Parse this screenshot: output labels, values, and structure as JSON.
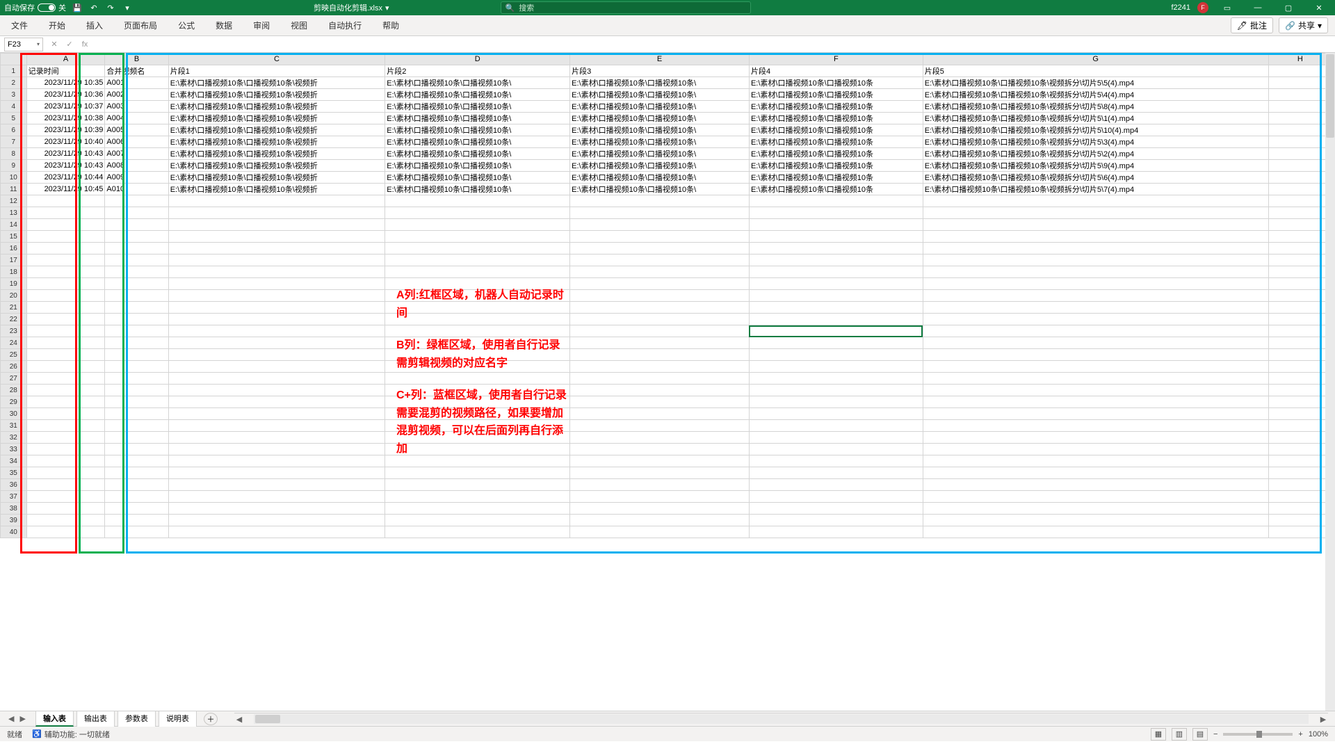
{
  "titlebar": {
    "autosave_label": "自动保存",
    "autosave_state": "关",
    "filename": "剪映自动化剪辑.xlsx",
    "search_placeholder": "搜索",
    "user_label": "f2241",
    "user_initial": "F"
  },
  "ribbon": {
    "tabs": [
      "文件",
      "开始",
      "插入",
      "页面布局",
      "公式",
      "数据",
      "审阅",
      "视图",
      "自动执行",
      "帮助"
    ],
    "comments": "批注",
    "share": "共享"
  },
  "fxbar": {
    "namebox": "F23",
    "fx_symbol": "fx"
  },
  "columns": [
    "A",
    "B",
    "C",
    "D",
    "E",
    "F",
    "G",
    "H"
  ],
  "headers": {
    "A": "记录时间",
    "B": "合并视频名",
    "C": "片段1",
    "D": "片段2",
    "E": "片段3",
    "F": "片段4",
    "G": "片段5"
  },
  "rows": [
    {
      "A": "2023/11/29 10:35",
      "B": "A001",
      "C": "E:\\素材\\口播视频10条\\口播视频10条\\视频折",
      "D": "E:\\素材\\口播视频10条\\口播视频10条\\",
      "E": "E:\\素材\\口播视频10条\\口播视频10条\\",
      "F": "E:\\素材\\口播视频10条\\口播视频10条",
      "G": "E:\\素材\\口播视频10条\\口播视频10条\\视频拆分\\切片5\\5(4).mp4"
    },
    {
      "A": "2023/11/29 10:36",
      "B": "A002",
      "C": "E:\\素材\\口播视频10条\\口播视频10条\\视频折",
      "D": "E:\\素材\\口播视频10条\\口播视频10条\\",
      "E": "E:\\素材\\口播视频10条\\口播视频10条\\",
      "F": "E:\\素材\\口播视频10条\\口播视频10条",
      "G": "E:\\素材\\口播视频10条\\口播视频10条\\视频拆分\\切片5\\4(4).mp4"
    },
    {
      "A": "2023/11/29 10:37",
      "B": "A003",
      "C": "E:\\素材\\口播视频10条\\口播视频10条\\视频折",
      "D": "E:\\素材\\口播视频10条\\口播视频10条\\",
      "E": "E:\\素材\\口播视频10条\\口播视频10条\\",
      "F": "E:\\素材\\口播视频10条\\口播视频10条",
      "G": "E:\\素材\\口播视频10条\\口播视频10条\\视频拆分\\切片5\\8(4).mp4"
    },
    {
      "A": "2023/11/29 10:38",
      "B": "A004",
      "C": "E:\\素材\\口播视频10条\\口播视频10条\\视频折",
      "D": "E:\\素材\\口播视频10条\\口播视频10条\\",
      "E": "E:\\素材\\口播视频10条\\口播视频10条\\",
      "F": "E:\\素材\\口播视频10条\\口播视频10条",
      "G": "E:\\素材\\口播视频10条\\口播视频10条\\视频拆分\\切片5\\1(4).mp4"
    },
    {
      "A": "2023/11/29 10:39",
      "B": "A005",
      "C": "E:\\素材\\口播视频10条\\口播视频10条\\视频折",
      "D": "E:\\素材\\口播视频10条\\口播视频10条\\",
      "E": "E:\\素材\\口播视频10条\\口播视频10条\\",
      "F": "E:\\素材\\口播视频10条\\口播视频10条",
      "G": "E:\\素材\\口播视频10条\\口播视频10条\\视频拆分\\切片5\\10(4).mp4"
    },
    {
      "A": "2023/11/29 10:40",
      "B": "A006",
      "C": "E:\\素材\\口播视频10条\\口播视频10条\\视频折",
      "D": "E:\\素材\\口播视频10条\\口播视频10条\\",
      "E": "E:\\素材\\口播视频10条\\口播视频10条\\",
      "F": "E:\\素材\\口播视频10条\\口播视频10条",
      "G": "E:\\素材\\口播视频10条\\口播视频10条\\视频拆分\\切片5\\3(4).mp4"
    },
    {
      "A": "2023/11/29 10:43",
      "B": "A007",
      "C": "E:\\素材\\口播视频10条\\口播视频10条\\视频折",
      "D": "E:\\素材\\口播视频10条\\口播视频10条\\",
      "E": "E:\\素材\\口播视频10条\\口播视频10条\\",
      "F": "E:\\素材\\口播视频10条\\口播视频10条",
      "G": "E:\\素材\\口播视频10条\\口播视频10条\\视频拆分\\切片5\\2(4).mp4"
    },
    {
      "A": "2023/11/29 10:43",
      "B": "A008",
      "C": "E:\\素材\\口播视频10条\\口播视频10条\\视频折",
      "D": "E:\\素材\\口播视频10条\\口播视频10条\\",
      "E": "E:\\素材\\口播视频10条\\口播视频10条\\",
      "F": "E:\\素材\\口播视频10条\\口播视频10条",
      "G": "E:\\素材\\口播视频10条\\口播视频10条\\视频拆分\\切片5\\9(4).mp4"
    },
    {
      "A": "2023/11/29 10:44",
      "B": "A009",
      "C": "E:\\素材\\口播视频10条\\口播视频10条\\视频折",
      "D": "E:\\素材\\口播视频10条\\口播视频10条\\",
      "E": "E:\\素材\\口播视频10条\\口播视频10条\\",
      "F": "E:\\素材\\口播视频10条\\口播视频10条",
      "G": "E:\\素材\\口播视频10条\\口播视频10条\\视频拆分\\切片5\\6(4).mp4"
    },
    {
      "A": "2023/11/29 10:45",
      "B": "A010",
      "C": "E:\\素材\\口播视频10条\\口播视频10条\\视频折",
      "D": "E:\\素材\\口播视频10条\\口播视频10条\\",
      "E": "E:\\素材\\口播视频10条\\口播视频10条\\",
      "F": "E:\\素材\\口播视频10条\\口播视频10条",
      "G": "E:\\素材\\口播视频10条\\口播视频10条\\视频拆分\\切片5\\7(4).mp4"
    }
  ],
  "total_rows": 40,
  "selected_cell": {
    "row": 23,
    "col": "F"
  },
  "annotations": {
    "a": "A列:红框区域，机器人自动记录时\n间",
    "b": "B列：绿框区域，使用者自行记录\n需剪辑视频的对应名字",
    "c": "C+列：蓝框区域，使用者自行记录\n需要混剪的视频路径，如果要增加\n混剪视频，可以在后面列再自行添\n加"
  },
  "sheets": {
    "tabs": [
      "输入表",
      "输出表",
      "参数表",
      "说明表"
    ],
    "active": 0
  },
  "statusbar": {
    "ready": "就绪",
    "accessibility": "辅助功能: 一切就绪",
    "zoom": "100%"
  }
}
